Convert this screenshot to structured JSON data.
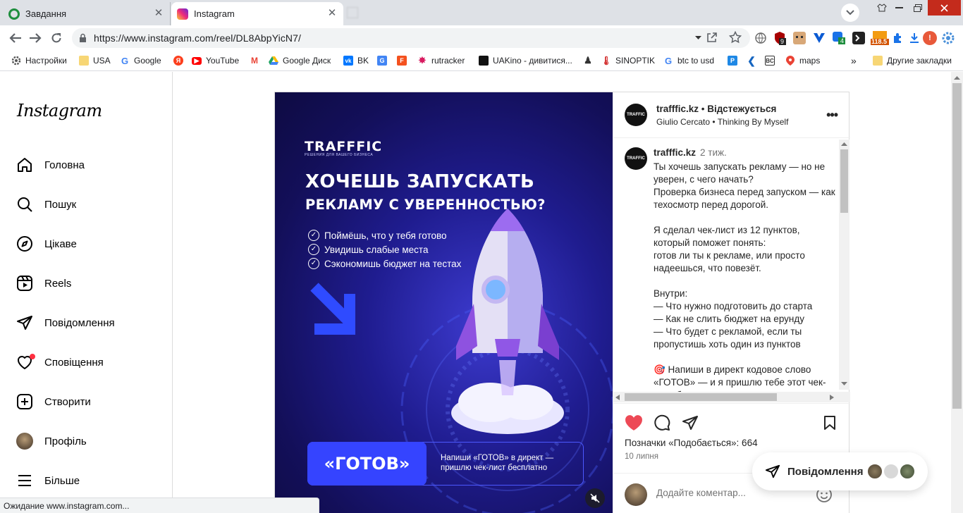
{
  "browser": {
    "tabs": [
      {
        "title": "Завдання",
        "active": false
      },
      {
        "title": "Instagram",
        "active": true
      }
    ],
    "url": "https://www.instagram.com/reel/DL8AbpYicN7/",
    "bookmarks": [
      {
        "label": "Настройки",
        "icon": "gear-icon"
      },
      {
        "label": "USA",
        "icon": "folder-icon"
      },
      {
        "label": "Google",
        "icon": "google-icon"
      },
      {
        "label": "",
        "icon": "yandex-icon"
      },
      {
        "label": "YouTube",
        "icon": "youtube-icon"
      },
      {
        "label": "",
        "icon": "gmail-icon"
      },
      {
        "label": "Google Диск",
        "icon": "drive-icon"
      },
      {
        "label": "BK",
        "icon": "vk-icon"
      },
      {
        "label": "",
        "icon": "translate-icon"
      },
      {
        "label": "",
        "icon": "app-icon"
      },
      {
        "label": "rutracker",
        "icon": "rutracker-icon"
      },
      {
        "label": "UAKino - дивитися...",
        "icon": "uakino-icon"
      },
      {
        "label": "",
        "icon": "chess-icon"
      },
      {
        "label": "SINOPTIK",
        "icon": "thermometer-icon"
      },
      {
        "label": "btc to usd",
        "icon": "google-icon"
      },
      {
        "label": "",
        "icon": "p-icon"
      },
      {
        "label": "",
        "icon": "arrow-icon"
      },
      {
        "label": "",
        "icon": "bc-icon"
      },
      {
        "label": "maps",
        "icon": "maps-icon"
      }
    ],
    "bookmarks_more": "»",
    "other_bookmarks": "Другие закладки",
    "ext_badges": {
      "yandex": "9",
      "sync": "4",
      "counter": "118.5"
    },
    "status_text": "Ожидание www.instagram.com..."
  },
  "sidebar": {
    "logo": "Instagram",
    "items": [
      {
        "label": "Головна",
        "icon": "home-icon"
      },
      {
        "label": "Пошук",
        "icon": "search-icon"
      },
      {
        "label": "Цікаве",
        "icon": "compass-icon"
      },
      {
        "label": "Reels",
        "icon": "reels-icon"
      },
      {
        "label": "Повідомлення",
        "icon": "messenger-icon"
      },
      {
        "label": "Сповіщення",
        "icon": "heart-icon"
      },
      {
        "label": "Створити",
        "icon": "plus-square-icon"
      },
      {
        "label": "Профіль",
        "icon": "profile-avatar"
      },
      {
        "label": "Більше",
        "icon": "menu-icon"
      }
    ]
  },
  "media": {
    "brand": "TRAFFFIC",
    "brand_sub": "РЕШЕНИЯ ДЛЯ ВАШЕГО БИЗНЕСА",
    "headline1": "ХОЧЕШЬ ЗАПУСКАТЬ",
    "headline2": "РЕКЛАМУ С УВЕРЕННОСТЬЮ?",
    "checks": [
      "Поймёшь, что у тебя готово",
      "Увидишь слабые места",
      "Сэкономишь бюджет на тестах"
    ],
    "cta_word": "«ГОТОВ»",
    "cta_text": "Напиши «ГОТОВ» в директ — пришлю чек-лист бесплатно"
  },
  "post": {
    "username": "trafffic.kz",
    "follow_state": "Відстежується",
    "audio_artist": "Giulio Cercato",
    "audio_track": "Thinking By Myself",
    "caption_user": "trafffic.kz",
    "caption_time": "2 тиж.",
    "caption": "Ты хочешь запускать рекламу — но не уверен, с чего начать?\nПроверка бизнеса перед запуском — как техосмотр перед дорогой.\n\nЯ сделал чек-лист из 12 пунктов, который поможет понять:\nготов ли ты к рекламе, или просто надеешься, что повезёт.\n\nВнутри:\n— Что нужно подготовить до старта\n— Как не слить бюджет на ерунду\n— Что будет с рекламой, если ты пропустишь хоть один из пунктов\n\n🎯 Напиши в директ кодовое слово «ГОТОВ» — и я пришлю тебе этот чек-лист бесплатно",
    "likes_label": "Позначки «Подобається»: 664",
    "date": "10 липня",
    "comment_placeholder": "Додайте коментар..."
  },
  "messages_pill": {
    "label": "Повідомлення"
  },
  "colors": {
    "like": "#ed4956",
    "cta": "#3544ff",
    "media_bg": "#1f1c8f"
  }
}
